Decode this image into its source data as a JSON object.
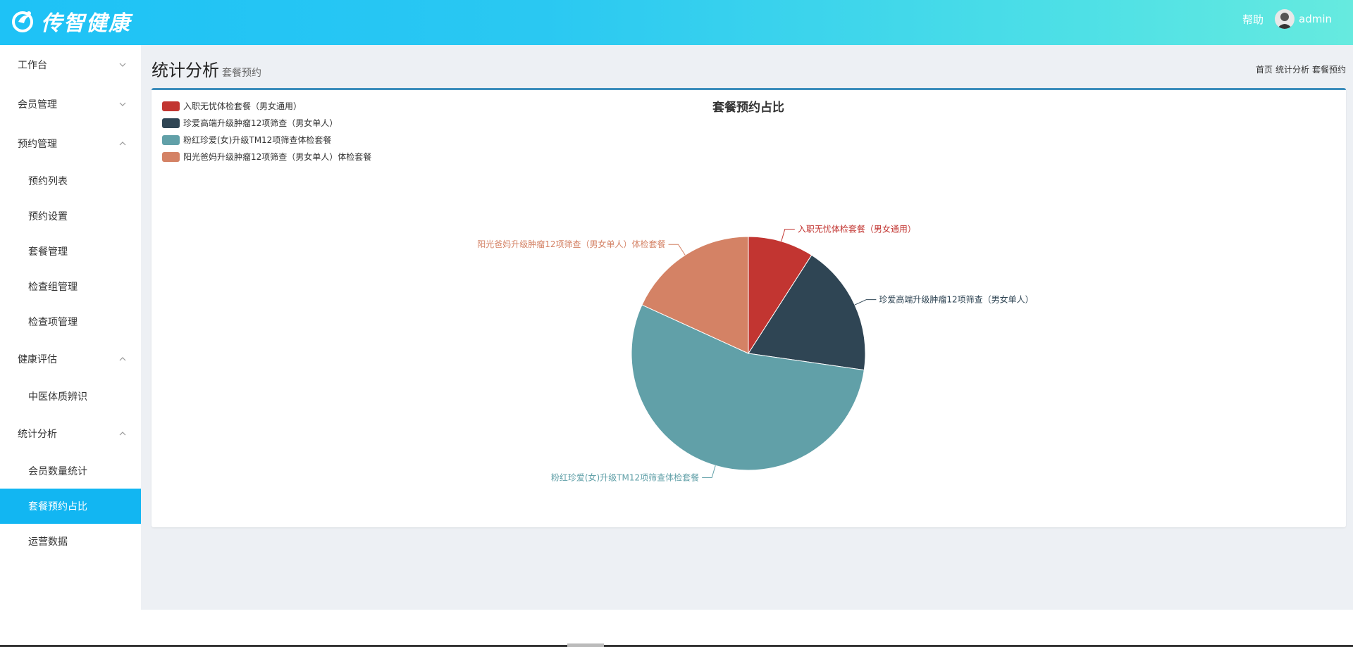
{
  "app": {
    "logo_text": "传智健康",
    "help_label": "帮助",
    "user_name": "admin"
  },
  "sidebar": {
    "groups": [
      {
        "label": "工作台",
        "expanded": false,
        "items": []
      },
      {
        "label": "会员管理",
        "expanded": false,
        "items": []
      },
      {
        "label": "预约管理",
        "expanded": true,
        "items": [
          "预约列表",
          "预约设置",
          "套餐管理",
          "检查组管理",
          "检查项管理"
        ]
      },
      {
        "label": "健康评估",
        "expanded": true,
        "items": [
          "中医体质辨识"
        ]
      },
      {
        "label": "统计分析",
        "expanded": true,
        "items": [
          "会员数量统计",
          "套餐预约占比",
          "运营数据"
        ]
      }
    ],
    "active_item": "套餐预约占比"
  },
  "page": {
    "title": "统计分析",
    "subtitle": "套餐预约",
    "breadcrumb": [
      "首页",
      "统计分析",
      "套餐预约"
    ]
  },
  "chart_data": {
    "type": "pie",
    "title": "套餐预约占比",
    "legend_position": "top-left",
    "slices": [
      {
        "name": "入职无忧体检套餐（男女通用）",
        "value": 1,
        "color": "#c23531"
      },
      {
        "name": "珍爱高端升级肿瘤12项筛查（男女单人）",
        "value": 2,
        "color": "#2f4554"
      },
      {
        "name": "粉红珍爱(女)升级TM12项筛查体检套餐",
        "value": 6,
        "color": "#61a0a8"
      },
      {
        "name": "阳光爸妈升级肿瘤12项筛查（男女单人）体检套餐",
        "value": 2,
        "color": "#d48265"
      }
    ]
  }
}
